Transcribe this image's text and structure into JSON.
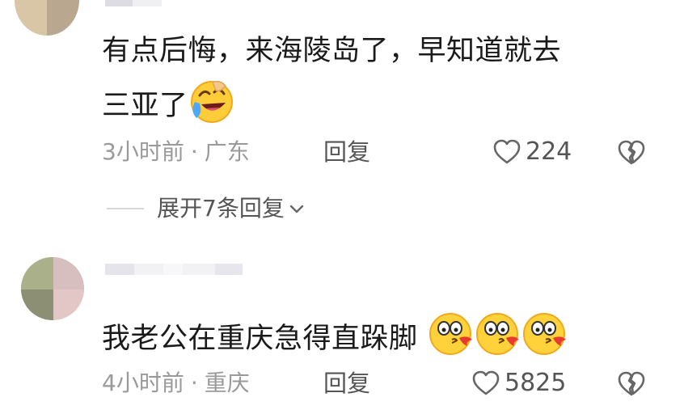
{
  "comments": [
    {
      "text_line1": "有点后悔，来海陵岛了，早知道就去",
      "text_line2": "三亚了",
      "emoji": "rolling-laughing-tears",
      "time": "3小时前",
      "location": "广东",
      "reply_label": "回复",
      "likes": "224",
      "expand_label": "展开7条回复"
    },
    {
      "text": "我老公在重庆急得直跺脚",
      "emojis": [
        "kissing-face",
        "kissing-face",
        "kissing-face"
      ],
      "time": "4小时前",
      "location": "重庆",
      "reply_label": "回复",
      "likes": "5825"
    }
  ],
  "separator": "·"
}
